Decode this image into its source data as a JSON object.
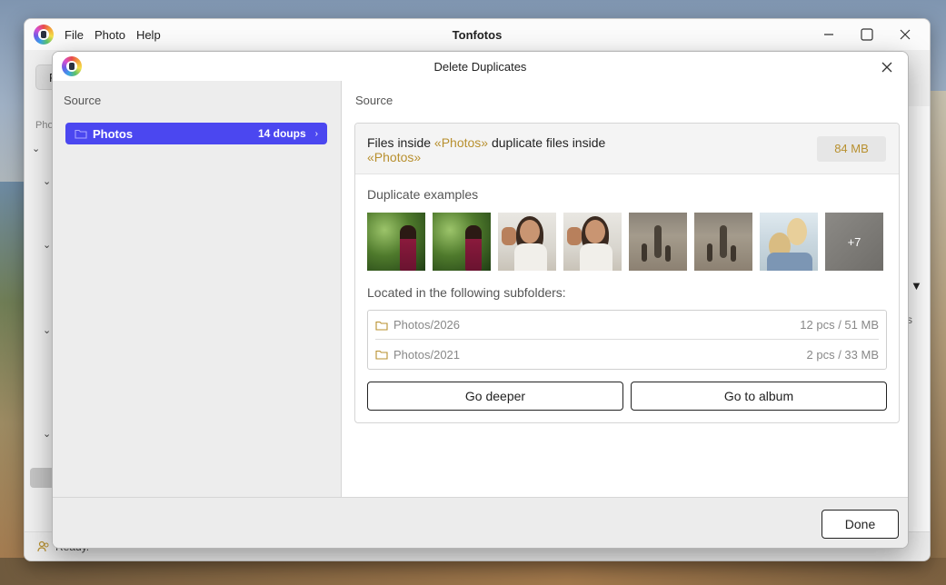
{
  "app": {
    "title": "Tonfotos",
    "menu": [
      "File",
      "Photo",
      "Help"
    ],
    "toolbar_initial": "F",
    "side_label": "Pho",
    "status": "Ready.",
    "right_panel_glyph": "▼",
    "right_panel_text": "s"
  },
  "dialog": {
    "title": "Delete Duplicates",
    "left_heading": "Source",
    "source_item": {
      "name": "Photos",
      "count": "14 doups",
      "arrow": "›"
    },
    "right_heading": "Source",
    "summary": {
      "prefix": "Files inside ",
      "source_name": "«Photos»",
      "middle": " duplicate files inside",
      "target_name": "«Photos»",
      "size": "84 MB"
    },
    "examples_label": "Duplicate examples",
    "more_count": "+7",
    "located_label": "Located in the following subfolders:",
    "subfolders": [
      {
        "path": "Photos/2026",
        "info": "12 pcs / 51 MB"
      },
      {
        "path": "Photos/2021",
        "info": "2 pcs / 33 MB"
      }
    ],
    "go_deeper": "Go deeper",
    "go_to_album": "Go to album",
    "done": "Done"
  },
  "colors": {
    "accent": "#b8902f",
    "selection": "#4b47f0"
  }
}
